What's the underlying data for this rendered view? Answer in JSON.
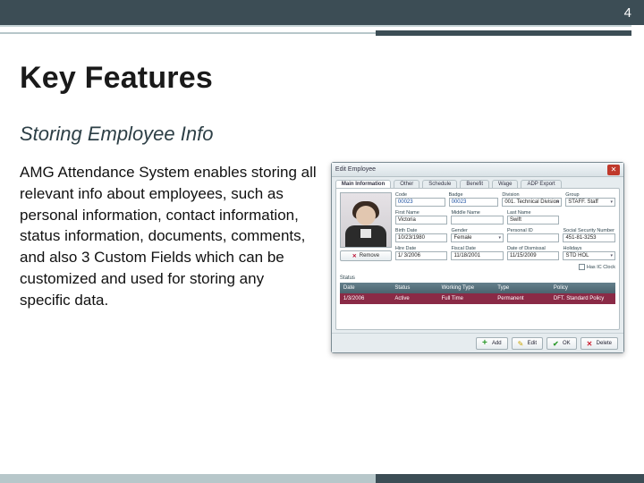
{
  "page_number": "4",
  "heading": "Key Features",
  "subheading": "Storing Employee Info",
  "paragraph": "AMG Attendance System enables storing all relevant info about employees, such as personal information, contact information, status information, documents, comments, and also 3 Custom Fields which can be customized and used for storing any specific data.",
  "dialog": {
    "title": "Edit Employee",
    "close_glyph": "✕",
    "tabs": [
      "Main Information",
      "Other",
      "Schedule",
      "Benefit",
      "Wage",
      "ADP Export"
    ],
    "remove_label": "Remove",
    "fields": {
      "row1": [
        {
          "label": "Code",
          "value": "00023",
          "kind": "text"
        },
        {
          "label": "Badge",
          "value": "00023",
          "kind": "text"
        },
        {
          "label": "Division",
          "value": "001. Technical Division",
          "kind": "select"
        },
        {
          "label": "Group",
          "value": "STAFF. Staff",
          "kind": "select"
        }
      ],
      "row2": [
        {
          "label": "First Name",
          "value": "Victoria",
          "kind": "text"
        },
        {
          "label": "Middle Name",
          "value": "",
          "kind": "text"
        },
        {
          "label": "Last Name",
          "value": "Swift",
          "kind": "text"
        },
        {
          "label": "",
          "value": "",
          "kind": "spacer"
        }
      ],
      "row3": [
        {
          "label": "Birth Date",
          "value": "10/23/1980",
          "kind": "date"
        },
        {
          "label": "Gender",
          "value": "Female",
          "kind": "select"
        },
        {
          "label": "Personal ID",
          "value": "",
          "kind": "text"
        },
        {
          "label": "Social Security Number",
          "value": "451-81-3253",
          "kind": "text"
        }
      ],
      "row4": [
        {
          "label": "Hire Date",
          "value": "1/ 3/2006",
          "kind": "date"
        },
        {
          "label": "Fiscal Date",
          "value": "11/18/2001",
          "kind": "date"
        },
        {
          "label": "Date of Dismissal",
          "value": "11/15/2009",
          "kind": "date"
        },
        {
          "label": "Holidays",
          "value": "STD HOL",
          "kind": "select"
        }
      ]
    },
    "has_ic_clock_checkbox_label": "Has IC Clock",
    "status_label": "Status",
    "status_columns": [
      "Date",
      "Status",
      "Working Type",
      "Type",
      "Policy"
    ],
    "status_rows": [
      {
        "date": "1/3/2006",
        "status": "Active",
        "working_type": "Full Time",
        "type": "Permanent",
        "policy": "DFT. Standard Policy"
      }
    ],
    "buttons": {
      "add": "Add",
      "edit": "Edit",
      "ok": "OK",
      "delete": "Delete"
    }
  }
}
